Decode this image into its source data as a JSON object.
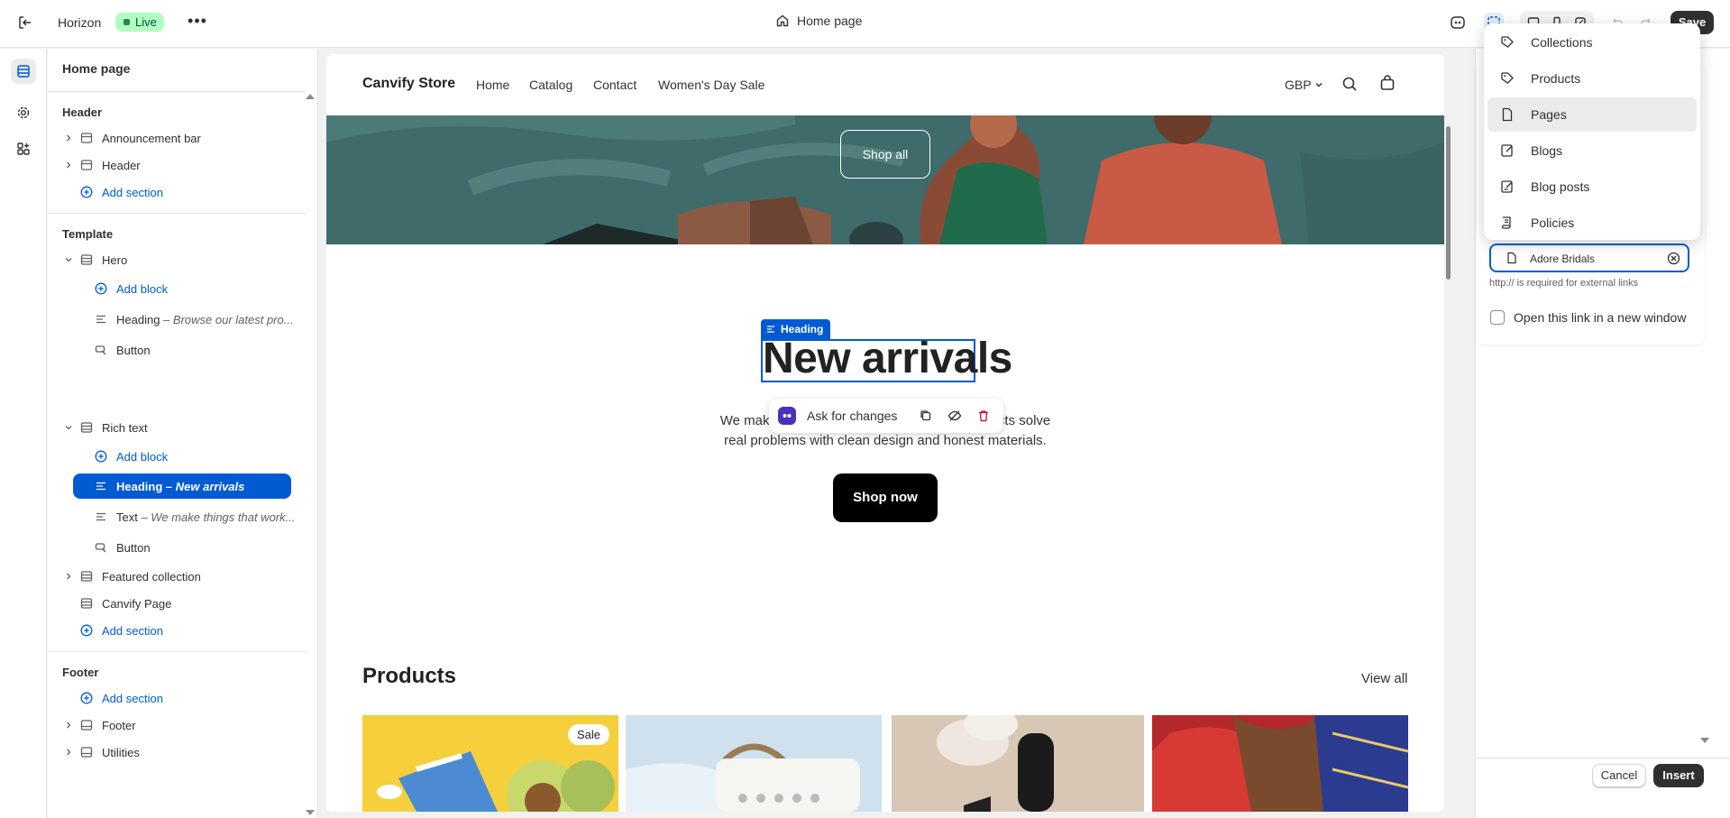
{
  "topbar": {
    "theme_name": "Horizon",
    "status": "Live",
    "page": "Home page",
    "save_label": "Save"
  },
  "sidebar": {
    "title": "Home page",
    "header_group": {
      "heading": "Header",
      "items": [
        {
          "label": "Announcement bar"
        },
        {
          "label": "Header"
        }
      ],
      "add_section": "Add section"
    },
    "template_group": {
      "heading": "Template",
      "hero": {
        "label": "Hero",
        "add_block": "Add block",
        "heading_label": "Heading",
        "heading_sub": "– Browse our latest pro...",
        "button_label": "Button"
      },
      "rich_text": {
        "label": "Rich text",
        "add_block": "Add block",
        "heading_label": "Heading",
        "heading_sub": "– New arrivals",
        "text_label": "Text",
        "text_sub": "– We make things that work...",
        "button_label": "Button"
      },
      "featured_collection": "Featured collection",
      "canvify_page": "Canvify Page",
      "add_section": "Add section"
    },
    "footer_group": {
      "heading": "Footer",
      "add_section": "Add section",
      "items": [
        {
          "label": "Footer"
        },
        {
          "label": "Utilities"
        }
      ]
    }
  },
  "preview": {
    "store_name": "Canvify Store",
    "nav": [
      "Home",
      "Catalog",
      "Contact",
      "Women's Day Sale"
    ],
    "currency": "GBP",
    "hero_button": "Shop all",
    "heading_tag": "Heading",
    "heading": "New arrivals",
    "rich_text_left": "We make thing",
    "rich_text_right": "products solve",
    "rich_text_line2": "real problems with clean design and honest materials.",
    "shop_now": "Shop now",
    "toolbar_ask": "Ask for changes",
    "products_title": "Products",
    "view_all": "View all",
    "sale_badge": "Sale"
  },
  "dropdown": {
    "items": [
      {
        "label": "Collections",
        "icon": "tag-icon"
      },
      {
        "label": "Products",
        "icon": "tag-icon"
      },
      {
        "label": "Pages",
        "icon": "page-icon"
      },
      {
        "label": "Blogs",
        "icon": "blog-icon"
      },
      {
        "label": "Blog posts",
        "icon": "blog-post-icon"
      },
      {
        "label": "Policies",
        "icon": "policy-icon"
      }
    ]
  },
  "link_picker": {
    "input_value": "Adore Bridals",
    "helper": "http:// is required for external links",
    "new_window_label": "Open this link in a new window",
    "cancel": "Cancel",
    "insert": "Insert"
  },
  "colors": {
    "accent": "#005bd3",
    "live_badge": "#affebf",
    "primary_button": "#303030"
  }
}
